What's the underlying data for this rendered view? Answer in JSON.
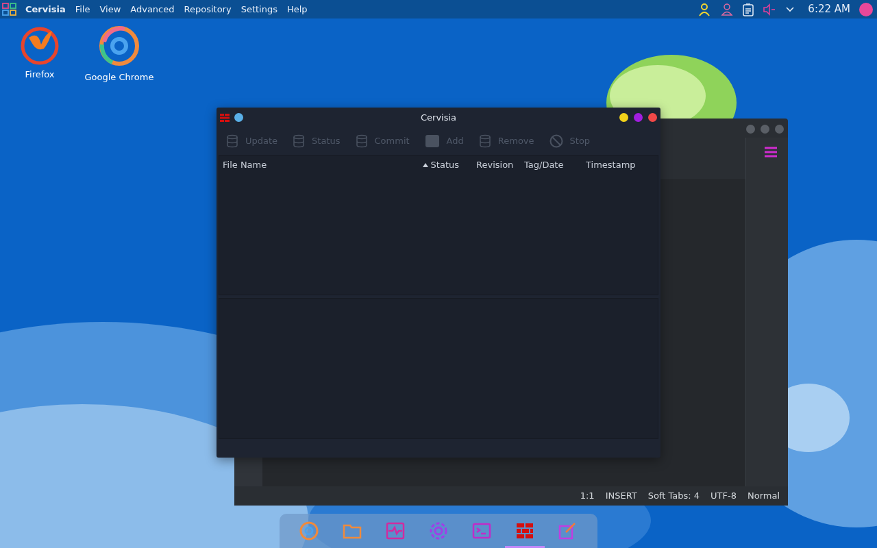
{
  "top_bar": {
    "app_name": "Cervisia",
    "menu": [
      "File",
      "View",
      "Advanced",
      "Repository",
      "Settings",
      "Help"
    ],
    "clock": "6:22 AM"
  },
  "desktop_icons": [
    {
      "label": "Firefox",
      "kind": "firefox"
    },
    {
      "label": "Google Chrome",
      "kind": "chrome"
    }
  ],
  "editor_window": {
    "status_bar": [
      "1:1",
      "INSERT",
      "Soft Tabs: 4",
      "UTF-8",
      "Normal"
    ]
  },
  "cervisia_window": {
    "title": "Cervisia",
    "toolbar": [
      {
        "label": "Update",
        "kind": "database",
        "disabled": true
      },
      {
        "label": "Status",
        "kind": "database",
        "disabled": true
      },
      {
        "label": "Commit",
        "kind": "database",
        "disabled": true
      },
      {
        "label": "Add",
        "kind": "box",
        "disabled": true
      },
      {
        "label": "Remove",
        "kind": "database",
        "disabled": true
      },
      {
        "label": "Stop",
        "kind": "stop",
        "disabled": true
      }
    ],
    "columns": [
      {
        "label": "File Name",
        "sorted": false
      },
      {
        "label": "Status",
        "sorted": true
      },
      {
        "label": "Revision",
        "sorted": false
      },
      {
        "label": "Tag/Date",
        "sorted": false
      },
      {
        "label": "Timestamp",
        "sorted": false
      }
    ]
  },
  "dock": [
    {
      "kind": "chrome",
      "active": false
    },
    {
      "kind": "folder",
      "active": false
    },
    {
      "kind": "monitor",
      "active": false
    },
    {
      "kind": "settings",
      "active": false
    },
    {
      "kind": "terminal",
      "active": false
    },
    {
      "kind": "bricks",
      "active": true
    },
    {
      "kind": "editor",
      "active": false
    }
  ]
}
